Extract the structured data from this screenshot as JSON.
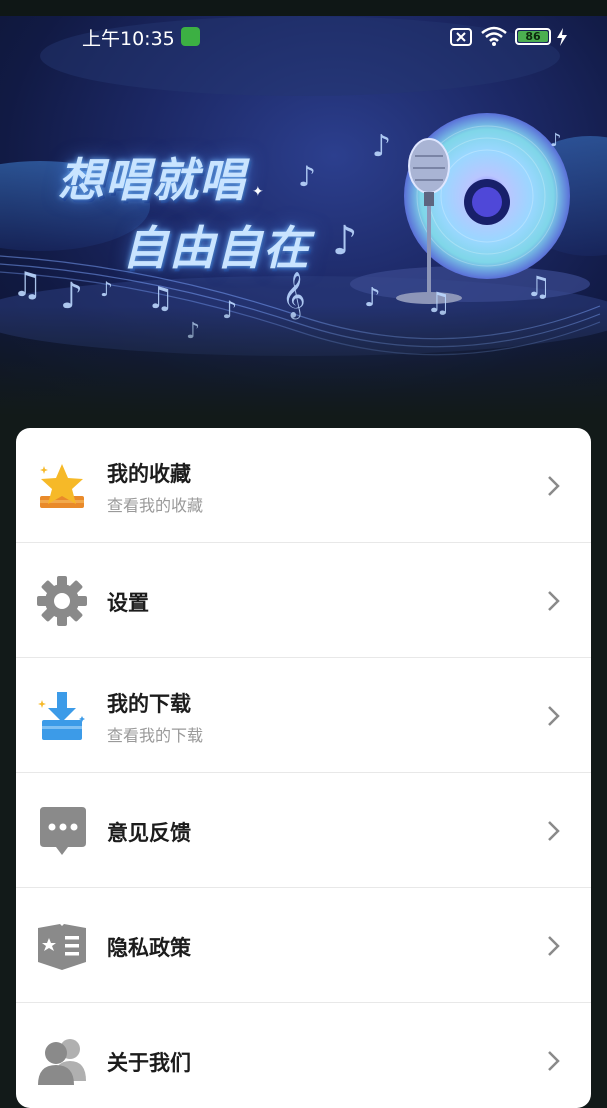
{
  "status_bar": {
    "time": "上午10:35",
    "battery": "86"
  },
  "banner": {
    "slogan_line1": "想唱就唱",
    "slogan_line2": "自由自在"
  },
  "menu": {
    "items": [
      {
        "icon": "star-icon",
        "title": "我的收藏",
        "subtitle": "查看我的收藏"
      },
      {
        "icon": "gear-icon",
        "title": "设置",
        "subtitle": ""
      },
      {
        "icon": "download-icon",
        "title": "我的下载",
        "subtitle": "查看我的下载"
      },
      {
        "icon": "chat-bubble-icon",
        "title": "意见反馈",
        "subtitle": ""
      },
      {
        "icon": "shield-book-icon",
        "title": "隐私政策",
        "subtitle": ""
      },
      {
        "icon": "users-icon",
        "title": "关于我们",
        "subtitle": ""
      }
    ]
  },
  "colors": {
    "background": "#121a19",
    "card": "#ffffff",
    "star_gold": "#f6b928",
    "download_blue": "#3c9be8",
    "icon_gray": "#8a8a8a"
  }
}
